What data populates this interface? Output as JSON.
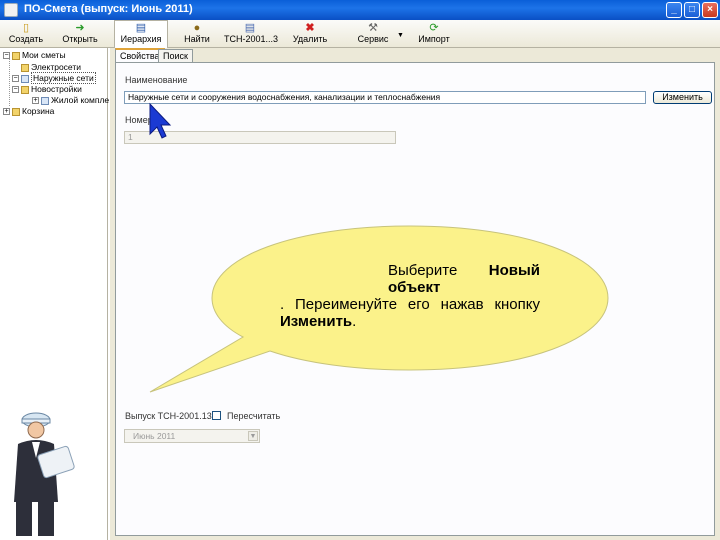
{
  "window": {
    "title": "ПО-Смета (выпуск: Июнь 2011)",
    "controls": [
      "_",
      "□",
      "×"
    ]
  },
  "toolbar": {
    "buttons": [
      {
        "label": "Создать",
        "icon": "new-doc-icon"
      },
      {
        "label": "Открыть",
        "icon": "arrow-right-icon"
      },
      {
        "label": "Иерархия",
        "icon": "hierarchy-icon"
      },
      {
        "label": "Найти",
        "icon": "find-icon"
      },
      {
        "label": "ТСН-2001...3",
        "icon": "book-icon"
      },
      {
        "label": "Удалить",
        "icon": "delete-icon"
      },
      {
        "label": "Сервис",
        "icon": "tools-icon"
      },
      {
        "label": "Импорт",
        "icon": "import-icon"
      }
    ]
  },
  "tree": {
    "items": [
      {
        "label": "Мои сметы",
        "icon": "folder-icon"
      },
      {
        "label": "Электросети",
        "icon": "folder-icon"
      },
      {
        "label": "Наружные сети",
        "icon": "folder-icon"
      },
      {
        "label": "Новостройки",
        "icon": "folder-icon"
      },
      {
        "label": "Жилой компле",
        "icon": "folder-icon"
      },
      {
        "label": "Корзина",
        "icon": "folder-icon"
      }
    ]
  },
  "tabs": [
    "Свойства",
    "Поиск"
  ],
  "form": {
    "name_label": "Наименование",
    "name_value": "Наружные сети и сооружения водоснабжения, канализации и теплоснабжения",
    "rename_button": "Изменить",
    "number_label": "Номер",
    "number_value": "1",
    "release_label": "Выпуск ТСН-2001.13",
    "recalc_label": "Пересчитать",
    "release_value": "Июнь 2011"
  },
  "callout": {
    "text_1": "Выберите ",
    "bold_1": "Новый объект",
    "text_2": ". Переименуйте его нажав кнопку ",
    "bold_2": "Изменить",
    "text_3": "."
  }
}
